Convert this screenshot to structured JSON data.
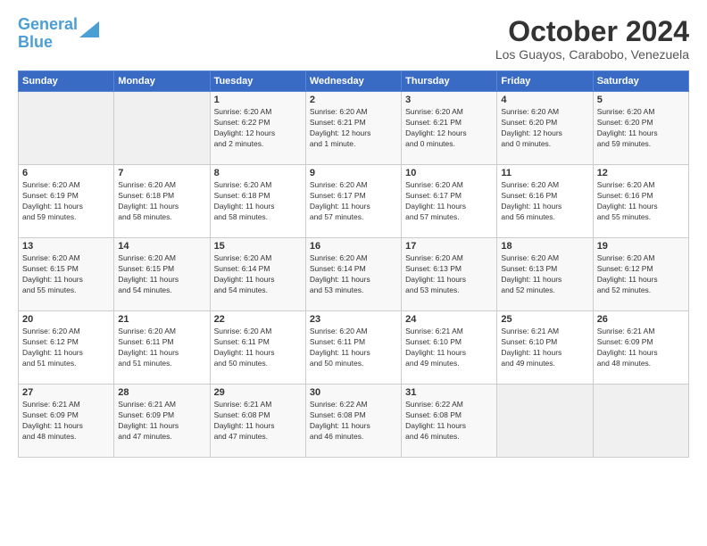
{
  "logo": {
    "line1": "General",
    "line2": "Blue"
  },
  "title": "October 2024",
  "subtitle": "Los Guayos, Carabobo, Venezuela",
  "days_of_week": [
    "Sunday",
    "Monday",
    "Tuesday",
    "Wednesday",
    "Thursday",
    "Friday",
    "Saturday"
  ],
  "weeks": [
    [
      {
        "day": "",
        "info": ""
      },
      {
        "day": "",
        "info": ""
      },
      {
        "day": "1",
        "info": "Sunrise: 6:20 AM\nSunset: 6:22 PM\nDaylight: 12 hours\nand 2 minutes."
      },
      {
        "day": "2",
        "info": "Sunrise: 6:20 AM\nSunset: 6:21 PM\nDaylight: 12 hours\nand 1 minute."
      },
      {
        "day": "3",
        "info": "Sunrise: 6:20 AM\nSunset: 6:21 PM\nDaylight: 12 hours\nand 0 minutes."
      },
      {
        "day": "4",
        "info": "Sunrise: 6:20 AM\nSunset: 6:20 PM\nDaylight: 12 hours\nand 0 minutes."
      },
      {
        "day": "5",
        "info": "Sunrise: 6:20 AM\nSunset: 6:20 PM\nDaylight: 11 hours\nand 59 minutes."
      }
    ],
    [
      {
        "day": "6",
        "info": "Sunrise: 6:20 AM\nSunset: 6:19 PM\nDaylight: 11 hours\nand 59 minutes."
      },
      {
        "day": "7",
        "info": "Sunrise: 6:20 AM\nSunset: 6:18 PM\nDaylight: 11 hours\nand 58 minutes."
      },
      {
        "day": "8",
        "info": "Sunrise: 6:20 AM\nSunset: 6:18 PM\nDaylight: 11 hours\nand 58 minutes."
      },
      {
        "day": "9",
        "info": "Sunrise: 6:20 AM\nSunset: 6:17 PM\nDaylight: 11 hours\nand 57 minutes."
      },
      {
        "day": "10",
        "info": "Sunrise: 6:20 AM\nSunset: 6:17 PM\nDaylight: 11 hours\nand 57 minutes."
      },
      {
        "day": "11",
        "info": "Sunrise: 6:20 AM\nSunset: 6:16 PM\nDaylight: 11 hours\nand 56 minutes."
      },
      {
        "day": "12",
        "info": "Sunrise: 6:20 AM\nSunset: 6:16 PM\nDaylight: 11 hours\nand 55 minutes."
      }
    ],
    [
      {
        "day": "13",
        "info": "Sunrise: 6:20 AM\nSunset: 6:15 PM\nDaylight: 11 hours\nand 55 minutes."
      },
      {
        "day": "14",
        "info": "Sunrise: 6:20 AM\nSunset: 6:15 PM\nDaylight: 11 hours\nand 54 minutes."
      },
      {
        "day": "15",
        "info": "Sunrise: 6:20 AM\nSunset: 6:14 PM\nDaylight: 11 hours\nand 54 minutes."
      },
      {
        "day": "16",
        "info": "Sunrise: 6:20 AM\nSunset: 6:14 PM\nDaylight: 11 hours\nand 53 minutes."
      },
      {
        "day": "17",
        "info": "Sunrise: 6:20 AM\nSunset: 6:13 PM\nDaylight: 11 hours\nand 53 minutes."
      },
      {
        "day": "18",
        "info": "Sunrise: 6:20 AM\nSunset: 6:13 PM\nDaylight: 11 hours\nand 52 minutes."
      },
      {
        "day": "19",
        "info": "Sunrise: 6:20 AM\nSunset: 6:12 PM\nDaylight: 11 hours\nand 52 minutes."
      }
    ],
    [
      {
        "day": "20",
        "info": "Sunrise: 6:20 AM\nSunset: 6:12 PM\nDaylight: 11 hours\nand 51 minutes."
      },
      {
        "day": "21",
        "info": "Sunrise: 6:20 AM\nSunset: 6:11 PM\nDaylight: 11 hours\nand 51 minutes."
      },
      {
        "day": "22",
        "info": "Sunrise: 6:20 AM\nSunset: 6:11 PM\nDaylight: 11 hours\nand 50 minutes."
      },
      {
        "day": "23",
        "info": "Sunrise: 6:20 AM\nSunset: 6:11 PM\nDaylight: 11 hours\nand 50 minutes."
      },
      {
        "day": "24",
        "info": "Sunrise: 6:21 AM\nSunset: 6:10 PM\nDaylight: 11 hours\nand 49 minutes."
      },
      {
        "day": "25",
        "info": "Sunrise: 6:21 AM\nSunset: 6:10 PM\nDaylight: 11 hours\nand 49 minutes."
      },
      {
        "day": "26",
        "info": "Sunrise: 6:21 AM\nSunset: 6:09 PM\nDaylight: 11 hours\nand 48 minutes."
      }
    ],
    [
      {
        "day": "27",
        "info": "Sunrise: 6:21 AM\nSunset: 6:09 PM\nDaylight: 11 hours\nand 48 minutes."
      },
      {
        "day": "28",
        "info": "Sunrise: 6:21 AM\nSunset: 6:09 PM\nDaylight: 11 hours\nand 47 minutes."
      },
      {
        "day": "29",
        "info": "Sunrise: 6:21 AM\nSunset: 6:08 PM\nDaylight: 11 hours\nand 47 minutes."
      },
      {
        "day": "30",
        "info": "Sunrise: 6:22 AM\nSunset: 6:08 PM\nDaylight: 11 hours\nand 46 minutes."
      },
      {
        "day": "31",
        "info": "Sunrise: 6:22 AM\nSunset: 6:08 PM\nDaylight: 11 hours\nand 46 minutes."
      },
      {
        "day": "",
        "info": ""
      },
      {
        "day": "",
        "info": ""
      }
    ]
  ]
}
